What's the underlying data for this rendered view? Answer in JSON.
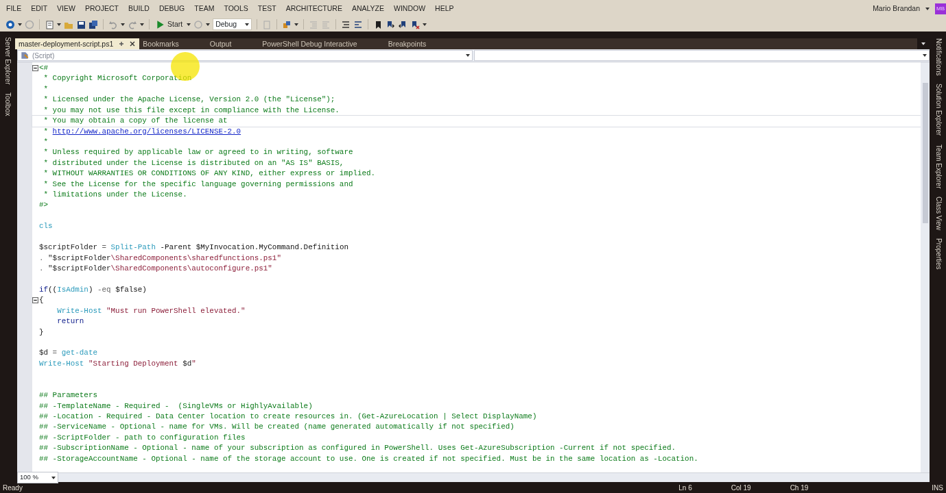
{
  "menu": [
    "FILE",
    "EDIT",
    "VIEW",
    "PROJECT",
    "BUILD",
    "DEBUG",
    "TEAM",
    "TOOLS",
    "TEST",
    "ARCHITECTURE",
    "ANALYZE",
    "WINDOW",
    "HELP"
  ],
  "user": {
    "name": "Mario Brandan",
    "initials": "MB"
  },
  "toolbar": {
    "start_label": "Start",
    "configuration": "Debug"
  },
  "left_panels": [
    "Server Explorer",
    "Toolbox"
  ],
  "right_panels": [
    "Notifications",
    "Solution Explorer",
    "Team Explorer",
    "Class View",
    "Properties"
  ],
  "tabs": [
    {
      "label": "master-deployment-script.ps1",
      "selected": true
    },
    {
      "label": "Bookmarks",
      "selected": false
    },
    {
      "label": "Output",
      "selected": false
    },
    {
      "label": "PowerShell Debug Interactive",
      "selected": false
    },
    {
      "label": "Breakpoints",
      "selected": false
    }
  ],
  "scope_dropdown": {
    "value": "(Script)"
  },
  "editor": {
    "zoom": "100 %",
    "lines": [
      {
        "fold": true,
        "highlighted": false,
        "tokens": [
          {
            "kind": "comment",
            "text": "<#"
          }
        ]
      },
      {
        "fold": false,
        "highlighted": false,
        "tokens": [
          {
            "kind": "comment",
            "text": " * Copyright Microsoft Corporation"
          }
        ]
      },
      {
        "fold": false,
        "highlighted": false,
        "tokens": [
          {
            "kind": "comment",
            "text": " *"
          }
        ]
      },
      {
        "fold": false,
        "highlighted": false,
        "tokens": [
          {
            "kind": "comment",
            "text": " * Licensed under the Apache License, Version 2.0 (the \"License\");"
          }
        ]
      },
      {
        "fold": false,
        "highlighted": false,
        "tokens": [
          {
            "kind": "comment",
            "text": " * you may not use this file except in compliance with the License."
          }
        ]
      },
      {
        "fold": false,
        "highlighted": true,
        "tokens": [
          {
            "kind": "comment",
            "text": " * You may obtain a copy of the license at"
          }
        ]
      },
      {
        "fold": false,
        "highlighted": false,
        "tokens": [
          {
            "kind": "comment",
            "text": " * "
          },
          {
            "kind": "link",
            "text": "http://www.apache.org/licenses/LICENSE-2.0"
          }
        ]
      },
      {
        "fold": false,
        "highlighted": false,
        "tokens": [
          {
            "kind": "comment",
            "text": " *"
          }
        ]
      },
      {
        "fold": false,
        "highlighted": false,
        "tokens": [
          {
            "kind": "comment",
            "text": " * Unless required by applicable law or agreed to in writing, software"
          }
        ]
      },
      {
        "fold": false,
        "highlighted": false,
        "tokens": [
          {
            "kind": "comment",
            "text": " * distributed under the License is distributed on an \"AS IS\" BASIS,"
          }
        ]
      },
      {
        "fold": false,
        "highlighted": false,
        "tokens": [
          {
            "kind": "comment",
            "text": " * WITHOUT WARRANTIES OR CONDITIONS OF ANY KIND, either express or implied."
          }
        ]
      },
      {
        "fold": false,
        "highlighted": false,
        "tokens": [
          {
            "kind": "comment",
            "text": " * See the License for the specific language governing permissions and"
          }
        ]
      },
      {
        "fold": false,
        "highlighted": false,
        "tokens": [
          {
            "kind": "comment",
            "text": " * limitations under the License."
          }
        ]
      },
      {
        "fold": false,
        "highlighted": false,
        "tokens": [
          {
            "kind": "comment",
            "text": "#>"
          }
        ]
      },
      {
        "fold": false,
        "highlighted": false
      },
      {
        "fold": false,
        "highlighted": false,
        "tokens": [
          {
            "kind": "cmdlet",
            "text": "cls"
          }
        ]
      },
      {
        "fold": false,
        "highlighted": false
      },
      {
        "fold": false,
        "highlighted": false,
        "tokens": [
          {
            "kind": "variable",
            "text": "$scriptFolder"
          },
          {
            "kind": "operator",
            "text": " = "
          },
          {
            "kind": "cmdlet",
            "text": "Split-Path"
          },
          {
            "kind": "plain",
            "text": " -Parent $MyInvocation.MyCommand.Definition"
          }
        ]
      },
      {
        "fold": false,
        "highlighted": false,
        "tokens": [
          {
            "kind": "operator",
            "text": ". "
          },
          {
            "kind": "variable",
            "text": "\"$scriptFolder"
          },
          {
            "kind": "string",
            "text": "\\SharedComponents\\sharedfunctions.ps1\""
          }
        ]
      },
      {
        "fold": false,
        "highlighted": false,
        "tokens": [
          {
            "kind": "operator",
            "text": ". "
          },
          {
            "kind": "variable",
            "text": "\"$scriptFolder"
          },
          {
            "kind": "string",
            "text": "\\SharedComponents\\autoconfigure.ps1\""
          }
        ]
      },
      {
        "fold": false,
        "highlighted": false
      },
      {
        "fold": false,
        "highlighted": false,
        "tokens": [
          {
            "kind": "keyword",
            "text": "if"
          },
          {
            "kind": "plain",
            "text": "(("
          },
          {
            "kind": "cmdlet",
            "text": "IsAdmin"
          },
          {
            "kind": "plain",
            "text": ") "
          },
          {
            "kind": "operator",
            "text": "-eq"
          },
          {
            "kind": "plain",
            "text": " $false)"
          }
        ]
      },
      {
        "fold": true,
        "highlighted": false,
        "tokens": [
          {
            "kind": "plain",
            "text": "{"
          }
        ]
      },
      {
        "fold": false,
        "highlighted": false,
        "tokens": [
          {
            "kind": "cmdlet",
            "text": "    Write-Host"
          },
          {
            "kind": "string",
            "text": " \"Must run PowerShell elevated.\""
          }
        ]
      },
      {
        "fold": false,
        "highlighted": false,
        "tokens": [
          {
            "kind": "keyword",
            "text": "    return"
          }
        ]
      },
      {
        "fold": false,
        "highlighted": false,
        "tokens": [
          {
            "kind": "plain",
            "text": "}"
          }
        ]
      },
      {
        "fold": false,
        "highlighted": false
      },
      {
        "fold": false,
        "highlighted": false,
        "tokens": [
          {
            "kind": "variable",
            "text": "$d"
          },
          {
            "kind": "operator",
            "text": " = "
          },
          {
            "kind": "cmdlet",
            "text": "get-date"
          }
        ]
      },
      {
        "fold": false,
        "highlighted": false,
        "tokens": [
          {
            "kind": "cmdlet",
            "text": "Write-Host"
          },
          {
            "kind": "string",
            "text": " \"Starting Deployment "
          },
          {
            "kind": "variable",
            "text": "$d"
          },
          {
            "kind": "string",
            "text": "\""
          }
        ]
      },
      {
        "fold": false,
        "highlighted": false
      },
      {
        "fold": false,
        "highlighted": false
      },
      {
        "fold": false,
        "highlighted": false,
        "tokens": [
          {
            "kind": "comment",
            "text": "## Parameters"
          }
        ]
      },
      {
        "fold": false,
        "highlighted": false,
        "tokens": [
          {
            "kind": "comment",
            "text": "## -TemplateName - Required -  (SingleVMs or HighlyAvailable)"
          }
        ]
      },
      {
        "fold": false,
        "highlighted": false,
        "tokens": [
          {
            "kind": "comment",
            "text": "## -Location - Required - Data Center location to create resources in. (Get-AzureLocation | Select DisplayName)"
          }
        ]
      },
      {
        "fold": false,
        "highlighted": false,
        "tokens": [
          {
            "kind": "comment",
            "text": "## -ServiceName - Optional - name for VMs. Will be created (name generated automatically if not specified)"
          }
        ]
      },
      {
        "fold": false,
        "highlighted": false,
        "tokens": [
          {
            "kind": "comment",
            "text": "## -ScriptFolder - path to configuration files"
          }
        ]
      },
      {
        "fold": false,
        "highlighted": false,
        "tokens": [
          {
            "kind": "comment",
            "text": "## -SubscriptionName - Optional - name of your subscription as configured in PowerShell. Uses Get-AzureSubscription -Current if not specified."
          }
        ]
      },
      {
        "fold": false,
        "highlighted": false,
        "tokens": [
          {
            "kind": "comment",
            "text": "## -StorageAccountName - Optional - name of the storage account to use. One is created if not specified. Must be in the same location as -Location."
          }
        ]
      }
    ]
  },
  "status_bar": {
    "message": "Ready",
    "line": "Ln 6",
    "column": "Col 19",
    "char": "Ch 19",
    "mode": "INS"
  }
}
